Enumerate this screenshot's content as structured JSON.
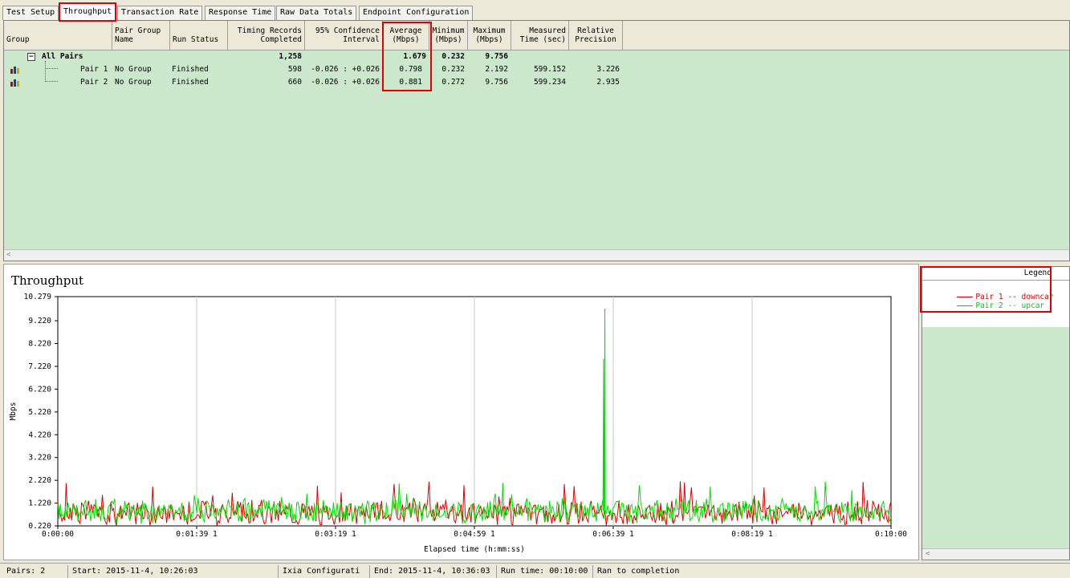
{
  "tabs": [
    {
      "label": "Test Setup",
      "active": false
    },
    {
      "label": "Throughput",
      "active": true
    },
    {
      "label": "Transaction Rate",
      "active": false
    },
    {
      "label": "Response Time",
      "active": false
    },
    {
      "label": "Raw Data Totals",
      "active": false
    },
    {
      "label": "Endpoint Configuration",
      "active": false
    }
  ],
  "table": {
    "headers": {
      "group": "Group",
      "pair_group_name": "Pair Group\nName",
      "run_status": "Run Status",
      "timing_records": "Timing Records\nCompleted",
      "confidence": "95% Confidence\nInterval",
      "average": "Average\n(Mbps)",
      "minimum": "Minimum\n(Mbps)",
      "maximum": "Maximum\n(Mbps)",
      "measured_time": "Measured\nTime (sec)",
      "relative_precision": "Relative\nPrecision"
    },
    "summary": {
      "expander": "−",
      "group": "All Pairs",
      "timing_records": "1,258",
      "average": "1.679",
      "minimum": "0.232",
      "maximum": "9.756"
    },
    "rows": [
      {
        "pair": "Pair 1",
        "group_name": "No Group",
        "status": "Finished",
        "records": "598",
        "confidence": "-0.026 : +0.026",
        "average": "0.798",
        "minimum": "0.232",
        "maximum": "2.192",
        "time": "599.152",
        "precision": "3.226"
      },
      {
        "pair": "Pair 2",
        "group_name": "No Group",
        "status": "Finished",
        "records": "660",
        "confidence": "-0.026 : +0.026",
        "average": "0.881",
        "minimum": "0.272",
        "maximum": "9.756",
        "time": "599.234",
        "precision": "2.935"
      }
    ],
    "scroll_arrow": "<"
  },
  "chart": {
    "title": "Throughput",
    "legend_header": "Legend",
    "legend_scroll_arrow": "<"
  },
  "chart_data": {
    "type": "line",
    "title": "Throughput",
    "xlabel": "Elapsed time (h:mm:ss)",
    "ylabel": "Mbps",
    "ylim": [
      0.22,
      10.279
    ],
    "yticks": [
      "10.279",
      "9.220",
      "8.220",
      "7.220",
      "6.220",
      "5.220",
      "4.220",
      "3.220",
      "2.220",
      "1.220",
      "0.220"
    ],
    "xticks": [
      "0:00:00",
      "0:01:39 1",
      "0:03:19 1",
      "0:04:59 1",
      "0:06:39 1",
      "0:08:19 1",
      "0:10:00"
    ],
    "xlim_seconds": [
      0,
      600
    ],
    "grid": true,
    "series": [
      {
        "name": "Pair 1 -- downcar",
        "color": "#e00000",
        "mean": 0.798,
        "min": 0.232,
        "max": 2.192,
        "points": 598
      },
      {
        "name": "Pair 2 -- upcar",
        "color": "#00e000",
        "mean": 0.881,
        "min": 0.272,
        "max": 9.756,
        "points": 660,
        "spikes": [
          {
            "x": 394,
            "y": 9.756
          },
          {
            "x": 393,
            "y": 7.55
          }
        ]
      }
    ]
  },
  "statusbar": {
    "pairs": "Pairs: 2",
    "start": "Start: 2015-11-4, 10:26:03",
    "config": "Ixia Configurati",
    "end": "End: 2015-11-4, 10:36:03",
    "run_time": "Run time: 00:10:00",
    "completion": "Ran to completion"
  }
}
